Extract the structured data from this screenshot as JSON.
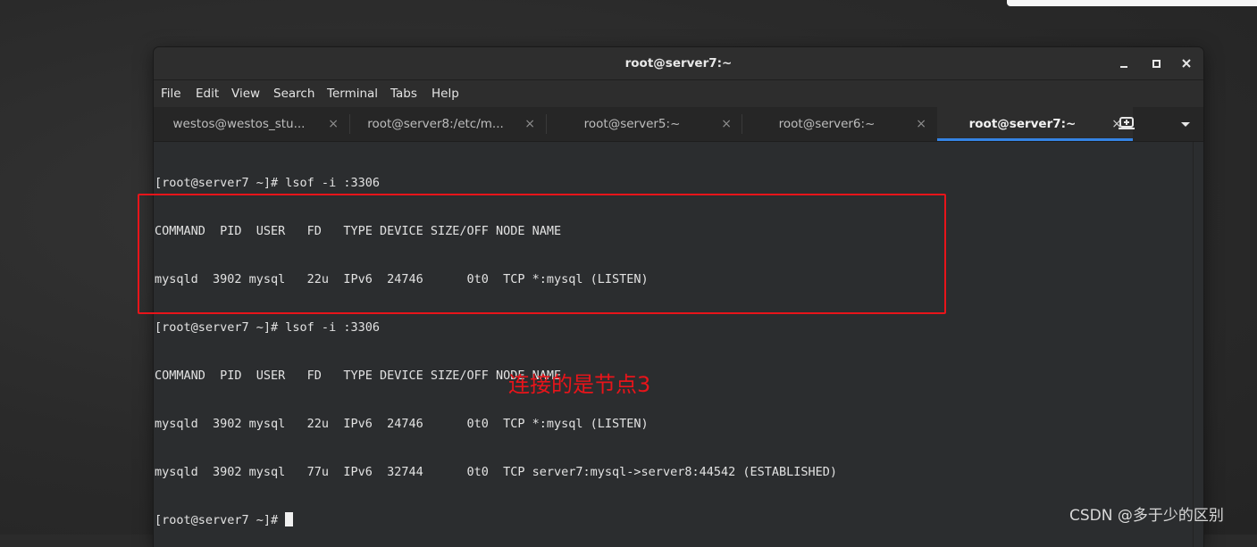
{
  "window": {
    "title": "root@server7:~"
  },
  "menubar": {
    "items": [
      "File",
      "Edit",
      "View",
      "Search",
      "Terminal",
      "Tabs",
      "Help"
    ]
  },
  "tabs": [
    {
      "label": "westos@westos_stu...",
      "active": false
    },
    {
      "label": "root@server8:/etc/m...",
      "active": false
    },
    {
      "label": "root@server5:~",
      "active": false
    },
    {
      "label": "root@server6:~",
      "active": false
    },
    {
      "label": "root@server7:~",
      "active": true
    }
  ],
  "tab_close_glyph": "×",
  "terminal": {
    "lines": [
      "[root@server7 ~]# lsof -i :3306",
      "COMMAND  PID  USER   FD   TYPE DEVICE SIZE/OFF NODE NAME",
      "mysqld  3902 mysql   22u  IPv6  24746      0t0  TCP *:mysql (LISTEN)",
      "[root@server7 ~]# lsof -i :3306",
      "COMMAND  PID  USER   FD   TYPE DEVICE SIZE/OFF NODE NAME",
      "mysqld  3902 mysql   22u  IPv6  24746      0t0  TCP *:mysql (LISTEN)",
      "mysqld  3902 mysql   77u  IPv6  32744      0t0  TCP server7:mysql->server8:44542 (ESTABLISHED)"
    ],
    "prompt": "[root@server7 ~]# "
  },
  "annotation": {
    "text": "连接的是节点3",
    "color": "#e8141a"
  },
  "watermark": {
    "text": "CSDN @多于少的区别"
  },
  "icons": {
    "new_tab": "new-tab-icon",
    "dropdown": "chevron-down-icon",
    "minimize": "minimize-icon",
    "maximize": "maximize-icon",
    "close": "close-icon"
  },
  "colors": {
    "accent": "#3584e4",
    "terminal_bg": "#2b2d2f",
    "terminal_fg": "#e2e2e2",
    "highlight": "#e8141a"
  }
}
